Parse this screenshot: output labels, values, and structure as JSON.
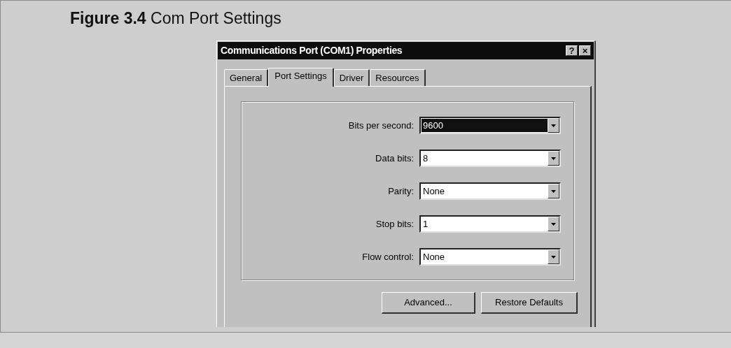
{
  "caption": {
    "label": "Figure 3.4",
    "title": "Com Port Settings"
  },
  "window": {
    "title": "Communications Port (COM1) Properties",
    "title_buttons": [
      "?",
      "×"
    ]
  },
  "tabs": [
    {
      "label": "General",
      "selected": false
    },
    {
      "label": "Port Settings",
      "selected": true
    },
    {
      "label": "Driver",
      "selected": false
    },
    {
      "label": "Resources",
      "selected": false
    }
  ],
  "fields": [
    {
      "label": "Bits per second:",
      "value": "9600",
      "focused": true
    },
    {
      "label": "Data bits:",
      "value": "8",
      "focused": false
    },
    {
      "label": "Parity:",
      "value": "None",
      "focused": false
    },
    {
      "label": "Stop bits:",
      "value": "1",
      "focused": false
    },
    {
      "label": "Flow control:",
      "value": "None",
      "focused": false
    }
  ],
  "buttons": [
    "Advanced...",
    "Restore Defaults"
  ]
}
